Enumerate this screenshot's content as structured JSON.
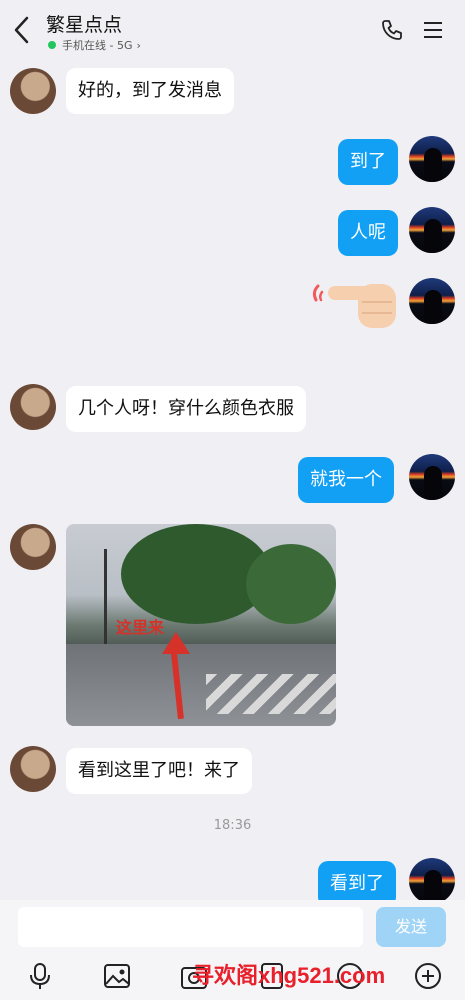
{
  "header": {
    "title": "繁星点点",
    "status": "手机在线 - 5G",
    "status_arrow": "›"
  },
  "messages": [
    {
      "side": "left",
      "text": "好的，到了发消息"
    },
    {
      "side": "right",
      "text": "到了"
    },
    {
      "side": "right",
      "text": "人呢"
    },
    {
      "side": "right",
      "type": "emoji",
      "icon": "pointing-hand-emoji"
    },
    {
      "side": "left",
      "text": "几个人呀！穿什么颜色衣服"
    },
    {
      "side": "right",
      "text": "就我一个"
    },
    {
      "side": "left",
      "type": "image",
      "overlay_text": "这里来"
    },
    {
      "side": "left",
      "text": "看到这里了吧！来了"
    },
    {
      "type": "time",
      "text": "18:36"
    },
    {
      "side": "right",
      "text": "看到了"
    }
  ],
  "input": {
    "placeholder": "",
    "send_label": "发送"
  },
  "toolbar_icons": [
    "microphone-icon",
    "image-icon",
    "camera-icon",
    "red-packet-icon",
    "emoji-icon",
    "plus-icon"
  ],
  "watermark": "寻欢阁xhg521.com",
  "colors": {
    "bubble_right": "#12a0f5",
    "bubble_left": "#ffffff",
    "background": "#f0f0f4",
    "online_dot": "#22c55e",
    "send_disabled": "#9fd4f7"
  }
}
